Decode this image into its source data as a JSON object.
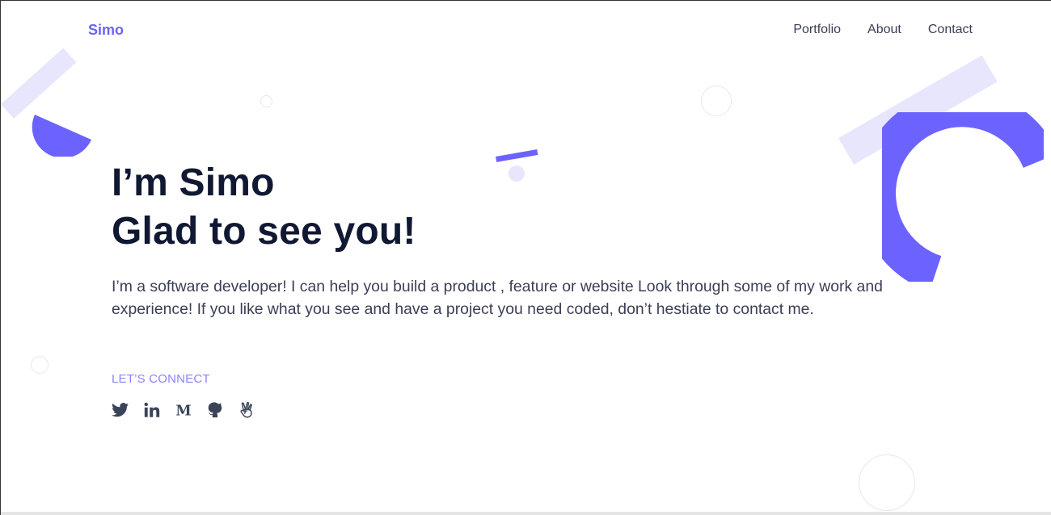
{
  "nav": {
    "brand": "Simo",
    "links": [
      {
        "label": "Portfolio"
      },
      {
        "label": "About"
      },
      {
        "label": "Contact"
      }
    ]
  },
  "hero": {
    "title_line1": "I’m Simo",
    "title_line2": "Glad to see you!",
    "description": "I’m a software developer! I can help you build a product , feature or website Look through some of my work and experience! If you like what you see and have a project you need coded, don’t hestiate to contact me.",
    "connect_label": "LET’S CONNECT"
  },
  "socials": [
    {
      "icon": "twitter-icon"
    },
    {
      "icon": "linkedin-icon"
    },
    {
      "icon": "medium-icon"
    },
    {
      "icon": "github-icon"
    },
    {
      "icon": "angellist-icon"
    }
  ],
  "colors": {
    "accent": "#6c63ff",
    "accent_light": "#e8e6fd",
    "heading": "#111833",
    "body_text": "#3b3f56",
    "connect_label": "#8b84fb"
  }
}
